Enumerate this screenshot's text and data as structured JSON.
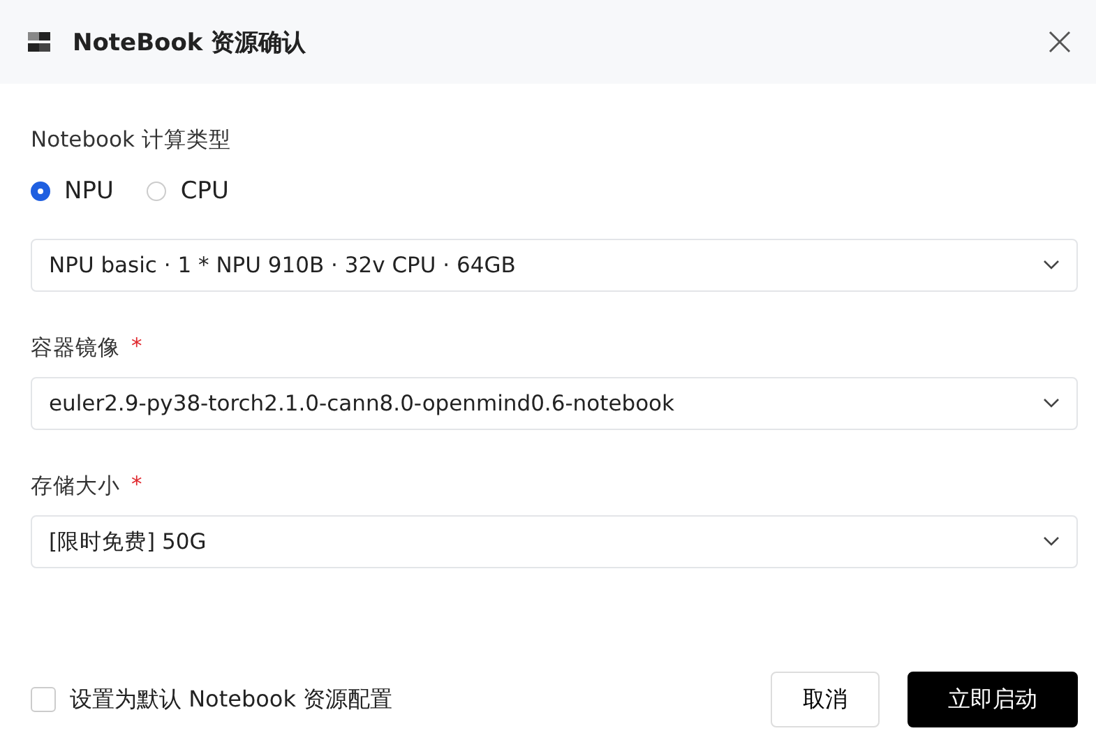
{
  "window": {
    "title": "NoteBook 资源确认"
  },
  "compute_type": {
    "label": "Notebook 计算类型",
    "options": [
      {
        "label": "NPU",
        "selected": true
      },
      {
        "label": "CPU",
        "selected": false
      }
    ]
  },
  "fields": [
    {
      "value": "NPU basic · 1 * NPU 910B · 32v CPU · 64GB"
    },
    {
      "label": "容器镜像",
      "required_mark": "*",
      "value": "euler2.9-py38-torch2.1.0-cann8.0-openmind0.6-notebook"
    },
    {
      "label": "存储大小",
      "required_mark": "*",
      "value": "[限时免费] 50G"
    }
  ],
  "footer": {
    "default_checkbox": {
      "label": "设置为默认 Notebook 资源配置",
      "checked": false
    },
    "buttons": [
      {
        "label": "取消",
        "kind": "secondary"
      },
      {
        "label": "立即启动",
        "kind": "primary"
      }
    ]
  }
}
